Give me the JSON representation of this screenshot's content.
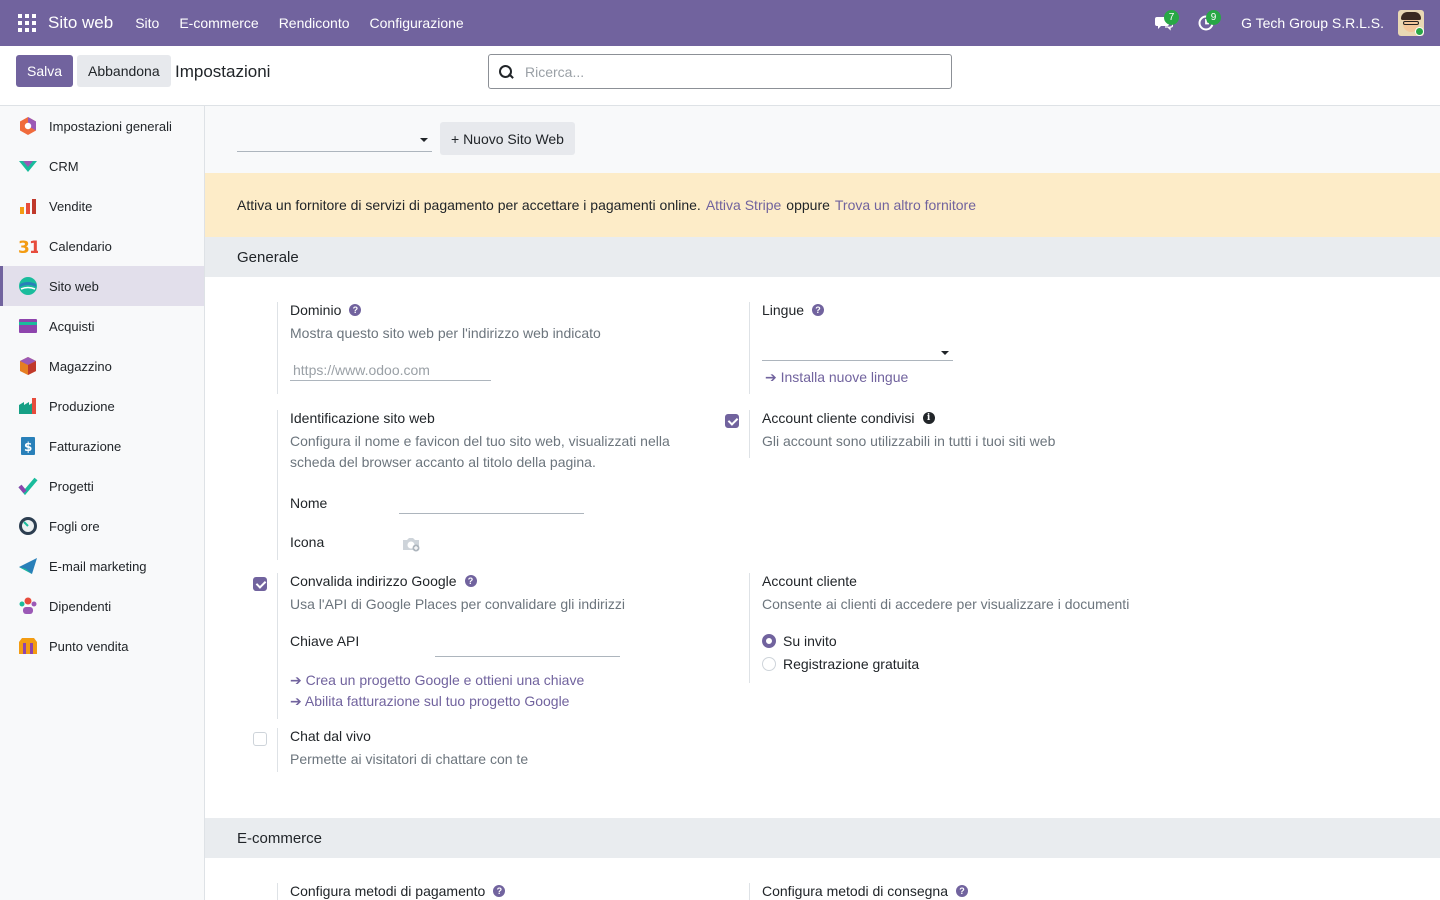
{
  "navbar": {
    "brand": "Sito web",
    "menu": [
      "Sito",
      "E-commerce",
      "Rendiconto",
      "Configurazione"
    ],
    "messages_badge": "7",
    "activities_badge": "9",
    "company": "G Tech Group S.R.L.S."
  },
  "control": {
    "save_label": "Salva",
    "discard_label": "Abbandona",
    "title": "Impostazioni",
    "search_placeholder": "Ricerca..."
  },
  "sidebar": {
    "items": [
      {
        "label": "Impostazioni generali",
        "icon": "general-settings-icon"
      },
      {
        "label": "CRM",
        "icon": "crm-icon"
      },
      {
        "label": "Vendite",
        "icon": "sales-icon"
      },
      {
        "label": "Calendario",
        "icon": "calendar-icon"
      },
      {
        "label": "Sito web",
        "icon": "website-icon",
        "active": true
      },
      {
        "label": "Acquisti",
        "icon": "purchase-icon"
      },
      {
        "label": "Magazzino",
        "icon": "inventory-icon"
      },
      {
        "label": "Produzione",
        "icon": "manufacturing-icon"
      },
      {
        "label": "Fatturazione",
        "icon": "invoicing-icon"
      },
      {
        "label": "Progetti",
        "icon": "project-icon"
      },
      {
        "label": "Fogli ore",
        "icon": "timesheet-icon"
      },
      {
        "label": "E-mail marketing",
        "icon": "email-marketing-icon"
      },
      {
        "label": "Dipendenti",
        "icon": "employees-icon"
      },
      {
        "label": "Punto vendita",
        "icon": "pos-icon"
      }
    ]
  },
  "main": {
    "new_site_label": "+ Nuovo Sito Web",
    "alert": {
      "text": "Attiva un fornitore di servizi di pagamento per accettare i pagamenti online.",
      "link1": "Attiva Stripe",
      "middle": "oppure",
      "link2": "Trova un altro fornitore"
    },
    "section_general": "Generale",
    "domain": {
      "label": "Dominio",
      "desc": "Mostra questo sito web per l'indirizzo web indicato",
      "placeholder": "https://www.odoo.com"
    },
    "languages": {
      "label": "Lingue",
      "link": "Installa nuove lingue"
    },
    "identity": {
      "label": "Identificazione sito web",
      "desc": "Configura il nome e favicon del tuo sito web, visualizzati nella scheda del browser accanto al titolo della pagina.",
      "name_label": "Nome",
      "icon_label": "Icona"
    },
    "shared_accounts": {
      "label": "Account cliente condivisi",
      "desc": "Gli account sono utilizzabili in tutti i tuoi siti web",
      "checked": true
    },
    "google_address": {
      "label": "Convalida indirizzo Google",
      "desc": "Usa l'API di Google Places per convalidare gli indirizzi",
      "api_label": "Chiave API",
      "link1": "Crea un progetto Google e ottieni una chiave",
      "link2": "Abilita fatturazione sul tuo progetto Google",
      "checked": true
    },
    "customer_account": {
      "label": "Account cliente",
      "desc": "Consente ai clienti di accedere per visualizzare i documenti",
      "option1": "Su invito",
      "option2": "Registrazione gratuita",
      "selected": "Su invito"
    },
    "live_chat": {
      "label": "Chat dal vivo",
      "desc": "Permette ai visitatori di chattare con te",
      "checked": false
    },
    "section_ecommerce": "E-commerce",
    "payment_methods": {
      "label": "Configura metodi di pagamento"
    },
    "shipping_methods": {
      "label": "Configura metodi di consegna"
    }
  },
  "colors": {
    "brand": "#71639e",
    "alert_bg": "#fdecc8",
    "badge": "#28a745"
  }
}
